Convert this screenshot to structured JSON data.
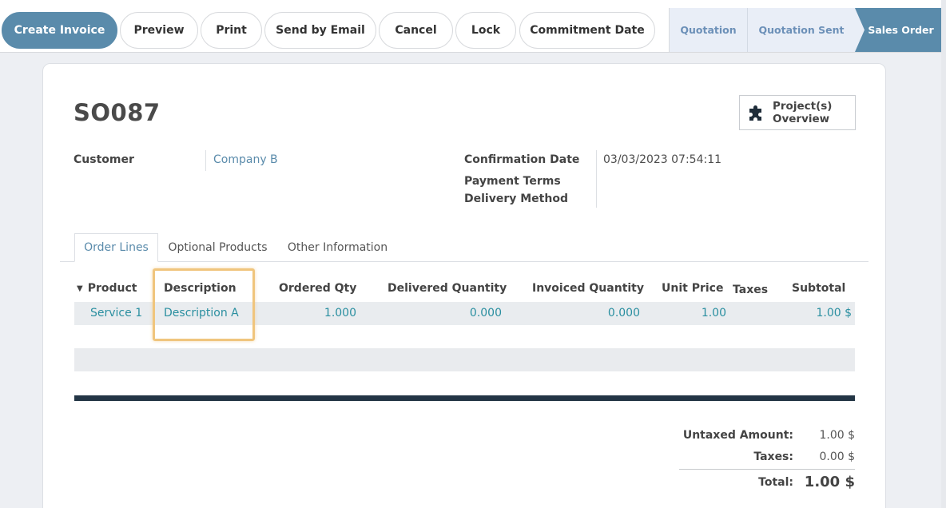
{
  "toolbar": {
    "create_invoice": "Create Invoice",
    "preview": "Preview",
    "print": "Print",
    "send_by_email": "Send by Email",
    "cancel": "Cancel",
    "lock": "Lock",
    "commitment_date": "Commitment Date"
  },
  "status_bar": {
    "stages": [
      "Quotation",
      "Quotation Sent",
      "Sales Order"
    ],
    "active": "Sales Order"
  },
  "record": {
    "name": "SO087",
    "smart_button": {
      "label": "Project(s) Overview",
      "icon": "puzzle-icon"
    }
  },
  "fields": {
    "customer_label": "Customer",
    "customer_value": "Company B",
    "confirmation_date_label": "Confirmation Date",
    "confirmation_date_value": "03/03/2023 07:54:11",
    "payment_terms_label": "Payment Terms",
    "delivery_method_label": "Delivery Method"
  },
  "tabs": [
    {
      "label": "Order Lines"
    },
    {
      "label": "Optional Products"
    },
    {
      "label": "Other Information"
    }
  ],
  "table": {
    "headers": {
      "product": "Product",
      "description": "Description",
      "ordered_qty": "Ordered Qty",
      "delivered_qty": "Delivered Quantity",
      "invoiced_qty": "Invoiced Quantity",
      "unit_price": "Unit Price",
      "taxes": "Taxes",
      "subtotal": "Subtotal"
    },
    "rows": [
      {
        "product": "Service 1",
        "description": "Description A",
        "ordered_qty": "1.000",
        "delivered_qty": "0.000",
        "invoiced_qty": "0.000",
        "unit_price": "1.00",
        "taxes": "",
        "subtotal": "1.00 $"
      }
    ]
  },
  "totals": {
    "untaxed_label": "Untaxed Amount:",
    "untaxed_value": "1.00 $",
    "taxes_label": "Taxes:",
    "taxes_value": "0.00 $",
    "total_label": "Total:",
    "total_value": "1.00 $"
  },
  "colors": {
    "primary": "#5a8bab",
    "link": "#2a8fa0",
    "highlight": "#f0c57d",
    "section_line": "#233545"
  }
}
